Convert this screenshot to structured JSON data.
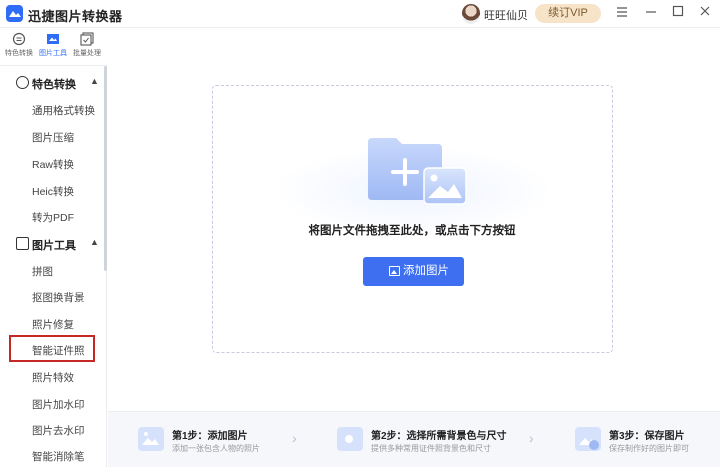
{
  "app": {
    "title": "迅捷图片转换器",
    "username": "旺旺仙贝",
    "vip_label": "续订VIP"
  },
  "window_controls": {
    "menu_icon": "menu-icon",
    "minimize_icon": "minimize-icon",
    "maximize_icon": "maximize-icon",
    "close_icon": "close-icon"
  },
  "modes": [
    {
      "label": "特色转换",
      "icon": "convert-icon"
    },
    {
      "label": "图片工具",
      "icon": "image-tool-icon",
      "active": true
    },
    {
      "label": "批量处理",
      "icon": "batch-icon"
    }
  ],
  "sidebar": {
    "groups": [
      {
        "label": "特色转换",
        "icon": "convert-circle-icon",
        "items": [
          "通用格式转换",
          "图片压缩",
          "Raw转换",
          "Heic转换",
          "转为PDF"
        ]
      },
      {
        "label": "图片工具",
        "icon": "image-tool-icon",
        "items": [
          "拼图",
          "抠图换背景",
          "照片修复",
          "智能证件照",
          "照片特效",
          "图片加水印",
          "图片去水印",
          "智能消除笔"
        ]
      }
    ],
    "selected_item": "智能证件照"
  },
  "main": {
    "drop_text": "将图片文件拖拽至此处，或点击下方按钮",
    "add_button": "添加图片"
  },
  "steps": [
    {
      "title": "第1步：添加图片",
      "desc": "添加一张包含人物的照片"
    },
    {
      "title": "第2步：选择所需背景色与尺寸",
      "desc": "提供多种常用证件照背景色和尺寸"
    },
    {
      "title": "第3步：保存图片",
      "desc": "保存制作好的图片即可"
    }
  ],
  "colors": {
    "accent": "#3e6ff0",
    "vip_bg": "#f7e4c8",
    "highlight": "#c62828"
  }
}
